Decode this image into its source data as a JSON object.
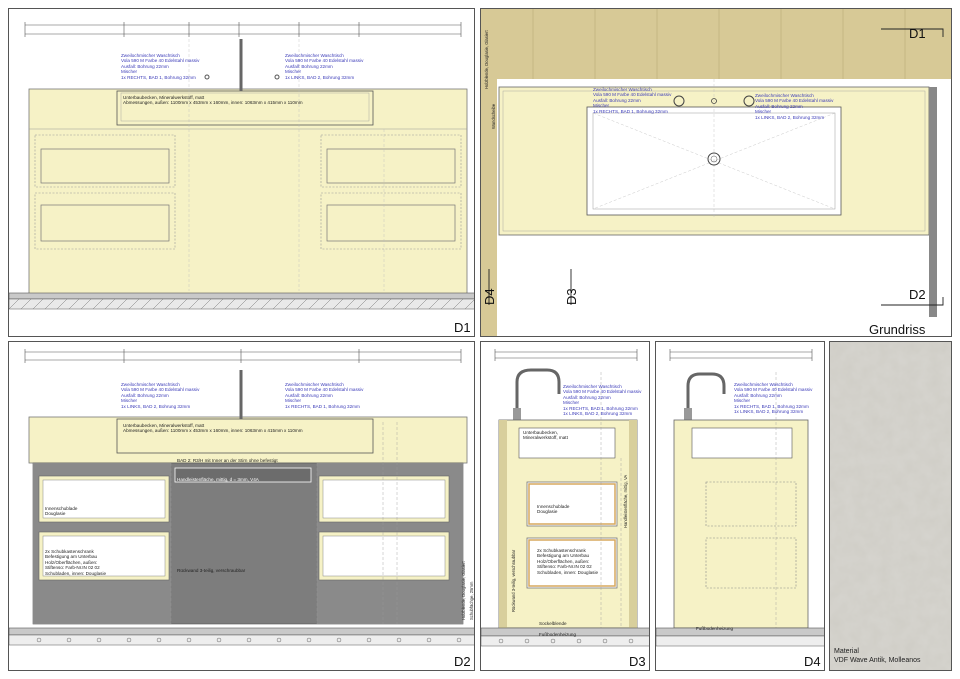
{
  "views": {
    "d1": {
      "label": "D1"
    },
    "grundriss": {
      "label": "Grundriss",
      "marker_d1": "D1",
      "marker_d2": "D2",
      "marker_d3": "D3",
      "marker_d4": "D4"
    },
    "d2": {
      "label": "D2"
    },
    "d3": {
      "label": "D3"
    },
    "d4": {
      "label": "D4"
    }
  },
  "notes": {
    "faucet_left": "Zweilochmischer Waschtisch\nVola 590 M Farbe 40 Edelstahl massiv\nAusfall: Bohrung 22mm\nMischer\n1x RECHTS, BAD 1, Bohrung 32mm",
    "faucet_right": "Zweilochmischer Waschtisch\nVola 590 M Farbe 40 Edelstahl massiv\nAusfall: Bohrung 22mm\nMischer\n1x LINKS, BAD 2, Bohrung 32mm",
    "basin": "Unterbaubecken, Mineralwerkstoff, matt\nAbmessungen, außen: 1100mm x 453mm x 160mm, innen: 1063mm x 415mm x 110mm",
    "faucet_left_d2": "Zweilochmischer Waschtisch\nVola 590 M Farbe 40 Edelstahl massiv\nAusfall: Bohrung 22mm\nMischer\n1x LINKS, BAD 2, Bohrung 32mm",
    "faucet_right_d2": "Zweilochmischer Waschtisch\nVola 590 M Farbe 40 Edelstahl massiv\nAusfall: Bohrung 22mm\nMischer\n1x RECHTS, BAD 1, Bohrung 32mm",
    "d2_top": "BAD 2: R3/H mit Inner an der Stirn ohne befestigt",
    "d2_handle": "Handleistenfläche, mittig, d = 3mm, V4A",
    "d2_inner": "Innenschublade\nDouglasie",
    "d2_drawers": "2x Schubkastenschrank\nBefestigung am Unterbau\nHolz/Oberflächen, außen:\nStiftenso: Farb-Nr.IN 02 02\nSchubladen, innen: Douglasie",
    "d2_center": "Rückwand 3-teilig, verschraubbar",
    "d2_side": "Holzblende, Douglasie, Glasiert",
    "d2_side2": "Schubfächge, 25mm",
    "d3_faucet": "Zweilochmischer Waschtisch\nVola 590 M Farbe 40 Edelstahl massiv\nAusfall: Bohrung 22mm\nMischer\n1x RECHTS, BAD 1, Bohrung 32mm\n1x LINKS, BAD 2, Bohrung 32mm",
    "d3_basin": "Unterbaubecken,\nMineralwerkstoff, matt",
    "d3_inner": "Innenschublade\nDouglasie",
    "d3_drawers": "2x Schubkastenschrank\nBefestigung am Unterbau\nHolz/Oberflächen, außen:\nStiftenso: Farb-Nr.IN 02 02\nSchubladen, innen: Douglasie",
    "d3_socket": "Sockelblende",
    "d3_floor": "Fußbodenheizung",
    "d3_side": "Rückwand 3-teilig, verschraubbar",
    "d3_rail": "Handleistenfläche, mittig, VA",
    "d4_faucet": "Zweilochmischer Waschtisch\nVola 590 M Farbe 40 Edelstahl massiv\nAusfall: Bohrung 22mm\nMischer\n1x RECHTS, BAD 1, Bohrung 32mm\n1x LINKS, BAD 2, Bohrung 32mm",
    "d4_floor": "Fußbodenheizung",
    "gr_left": "Zweilochmischer Waschtisch\nVola 590 M Farbe 40 Edelstahl massiv\nAusfall: Bohrung 22mm\nMischer\n1x RECHTS, BAD 1, Bohrung 32mm",
    "gr_right": "Zweilochmischer Waschtisch\nVola 590 M Farbe 40 Edelstahl massiv\nAusfall: Bohrung 22mm\nMischer\n1x LINKS, BAD 2, Bohrung 32mm",
    "gr_wall": "Holzblende, Douglasie, Glasiert",
    "gr_wall2": "Wandscheibe",
    "d1_side": "Holzblende, Douglasie, Glasiert"
  },
  "material": {
    "line1": "Material",
    "line2": "VDF Wave Antik, Molleanos"
  },
  "colors": {
    "counter": "#f6f2c6",
    "gray": "#7d7d7d",
    "beam": "#d7c996",
    "blue": "#3a3ab8"
  }
}
